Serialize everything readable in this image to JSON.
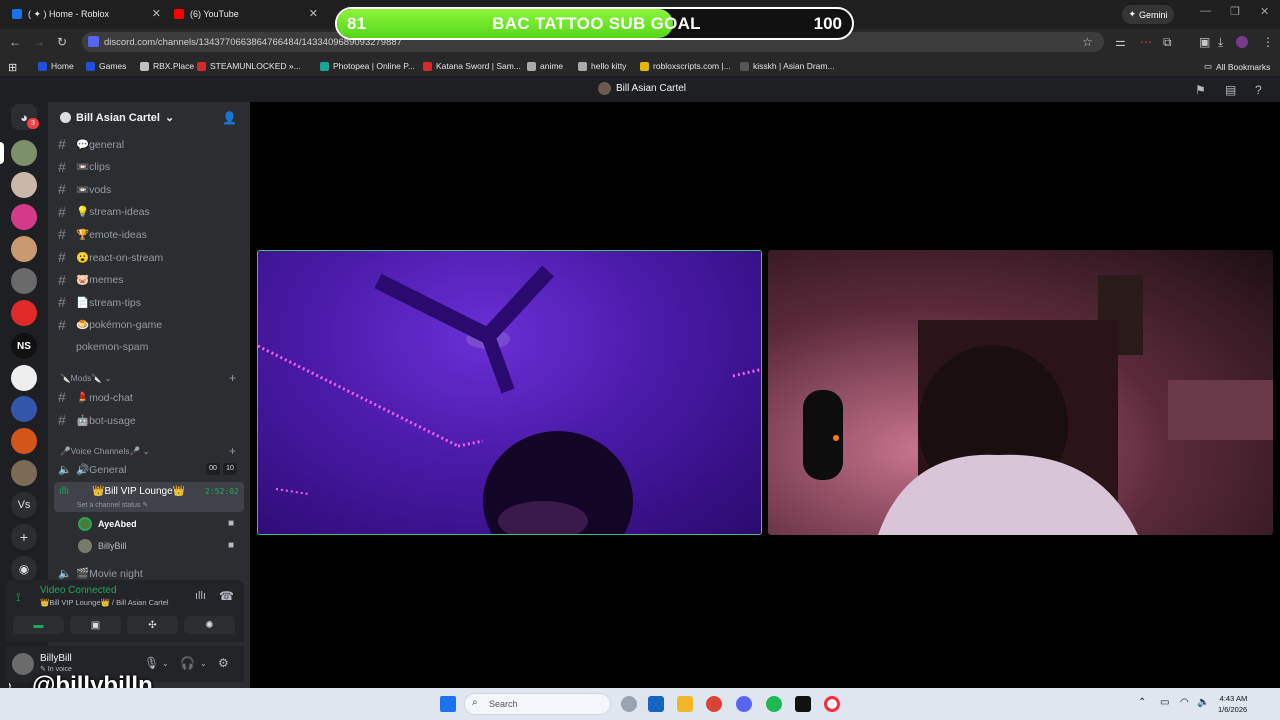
{
  "browser": {
    "tabs": [
      {
        "label": "( ✦ ) Home - Roblox",
        "color": "#1a73e8"
      },
      {
        "label": "(6) YouTube",
        "color": "#ff0000"
      }
    ],
    "gemini": "Gemini",
    "url": "discord.com/channels/1343770663864766484/1433409689093279887",
    "bookmarks": [
      {
        "label": "Home",
        "color": "#1e4fd9"
      },
      {
        "label": "Games",
        "color": "#1e4fd9"
      },
      {
        "label": "RBX.Place",
        "color": "#c0c0c0"
      },
      {
        "label": "STEAMUNLOCKED »...",
        "color": "#d42a2a"
      },
      {
        "label": "Photopea | Online P...",
        "color": "#18a497"
      },
      {
        "label": "Katana Sword | Sam...",
        "color": "#d42a2a"
      },
      {
        "label": "anime",
        "color": "#aaaaaa"
      },
      {
        "label": "hello kitty",
        "color": "#aaaaaa"
      },
      {
        "label": "robloxscripts.com |...",
        "color": "#e0b800"
      },
      {
        "label": "kisskh | Asian Dram...",
        "color": "#555555"
      }
    ],
    "all_bookmarks": "All Bookmarks"
  },
  "overlay": {
    "title": "BAC TATTOO SUB GOAL",
    "current": "81",
    "target": "100",
    "progress": 0.81
  },
  "discord": {
    "window_title": "Bill Asian Cartel",
    "dm_badge": "3",
    "server_name": "Bill Asian Cartel",
    "servers": [
      "#7a8f6a",
      "#c9b8a8",
      "#d43a8a",
      "#c99a70",
      "#6a6a6a",
      "#e02a2a",
      "#111111",
      "#eeeeee",
      "#3355aa",
      "#d2561a",
      "#7b6a55"
    ],
    "server_labels": {
      "ns": "NS",
      "vs": "Vs"
    },
    "channels": [
      {
        "name": "💬general"
      },
      {
        "name": "📼clips"
      },
      {
        "name": "📼vods"
      },
      {
        "name": "💡stream-ideas"
      },
      {
        "name": "🏆emote-ideas"
      },
      {
        "name": "😮react-on-stream"
      },
      {
        "name": "🐷memes"
      },
      {
        "name": "📄stream-tips"
      },
      {
        "name": "🍮pokémon-game"
      },
      {
        "name": "pokemon-spam"
      }
    ],
    "mods_category": "🔪Mods🔪",
    "mod_channels": [
      {
        "name": "💄mod-chat"
      },
      {
        "name": "🤖bot-usage"
      }
    ],
    "voice_category": "🎤Voice Channels🎤",
    "voice_general": "🔊General",
    "general_counts": [
      "00",
      "10"
    ],
    "vip_channel": "👑Bill VIP Lounge👑",
    "vip_timer": "2:52:02",
    "vip_status": "Set a channel status ✎",
    "voice_users": [
      {
        "name": "AyeAbed",
        "color": "#ffffff"
      },
      {
        "name": "BillyBill",
        "color": "#b5bac1"
      }
    ],
    "movie_channel": "🎬Movie night",
    "voice_connected": "Video Connected",
    "voice_location": "👑Bill VIP Lounge👑 / Bill Asian Cartel",
    "user_name": "BillyBill",
    "user_status": "✎ In voice"
  },
  "watermark": "@billybilln",
  "taskbar": {
    "search": "Search",
    "time": "4:43 AM",
    "date": "1/6/2026"
  }
}
